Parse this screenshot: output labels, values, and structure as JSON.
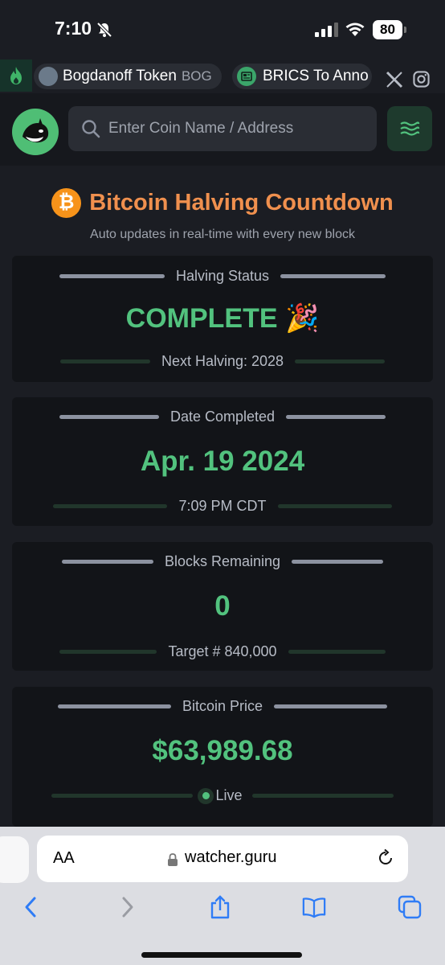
{
  "status_bar": {
    "time": "7:10",
    "battery": "80"
  },
  "ticker": {
    "items": [
      {
        "name": "Bogdanoff Token",
        "symbol": "BOG"
      },
      {
        "name": "BRICS To Anno"
      }
    ]
  },
  "search": {
    "placeholder": "Enter Coin Name / Address"
  },
  "page": {
    "title": "Bitcoin Halving Countdown",
    "subtitle": "Auto updates in real-time with every new block"
  },
  "cards": {
    "status": {
      "label": "Halving Status",
      "value": "COMPLETE 🎉",
      "sub": "Next Halving: 2028"
    },
    "date": {
      "label": "Date Completed",
      "value": "Apr. 19 2024",
      "sub": "7:09 PM CDT"
    },
    "blocks": {
      "label": "Blocks Remaining",
      "value": "0",
      "sub": "Target # 840,000"
    },
    "price": {
      "label": "Bitcoin Price",
      "value": "$63,989.68",
      "sub": "Live"
    }
  },
  "browser": {
    "aa": "AA",
    "url": "watcher.guru"
  },
  "colors": {
    "accent_green": "#52c27e",
    "title_orange": "#f0904e",
    "bitcoin_orange": "#f7931a"
  }
}
